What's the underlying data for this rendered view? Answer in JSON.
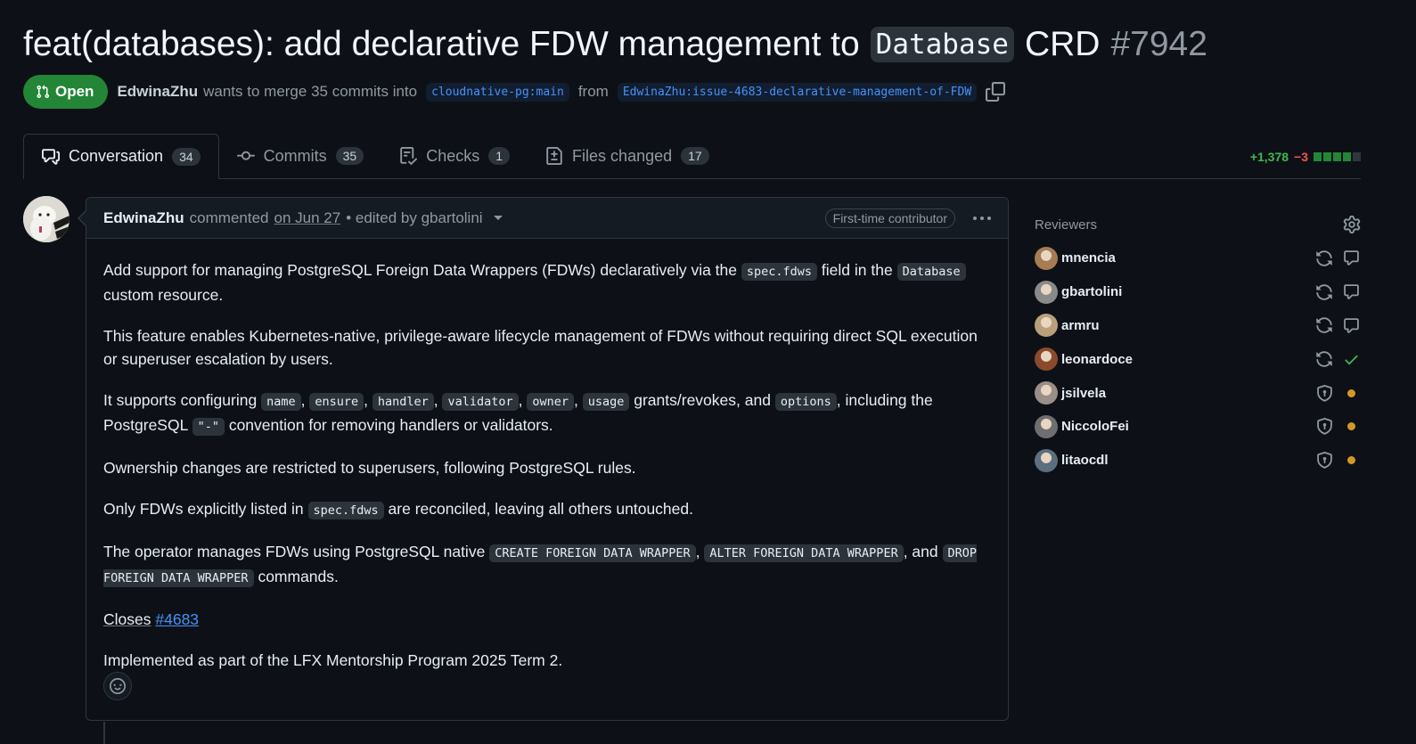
{
  "pr": {
    "title_prefix": "feat(databases): add declarative FDW management to",
    "title_code": "Database",
    "title_suffix": "CRD",
    "number": "#7942",
    "status": "Open",
    "author": "EdwinaZhu",
    "merge_text": "wants to merge 35 commits into",
    "base_branch": "cloudnative-pg:main",
    "from_text": "from",
    "head_branch": "EdwinaZhu:issue-4683-declarative-management-of-FDW"
  },
  "tabs": [
    {
      "label": "Conversation",
      "count": "34"
    },
    {
      "label": "Commits",
      "count": "35"
    },
    {
      "label": "Checks",
      "count": "1"
    },
    {
      "label": "Files changed",
      "count": "17"
    }
  ],
  "diffstat": {
    "additions": "+1,378",
    "deletions": "−3"
  },
  "comment": {
    "author": "EdwinaZhu",
    "commented": "commented",
    "date": "on Jun 27",
    "edited": "• edited by gbartolini",
    "badge": "First-time contributor",
    "p1_a": "Add support for managing PostgreSQL Foreign Data Wrappers (FDWs) declaratively via the",
    "p1_code1": "spec.fdws",
    "p1_b": "field in the",
    "p1_code2": "Database",
    "p1_c": "custom resource.",
    "p2": "This feature enables Kubernetes-native, privilege-aware lifecycle management of FDWs without requiring direct SQL execution or superuser escalation by users.",
    "p3_a": "It supports configuring",
    "p3_codes": [
      "name",
      "ensure",
      "handler",
      "validator",
      "owner",
      "usage"
    ],
    "p3_b": "grants/revokes, and",
    "p3_code_options": "options",
    "p3_c": ", including the PostgreSQL",
    "p3_code_dash": "\"-\"",
    "p3_d": "convention for removing handlers or validators.",
    "p4": "Ownership changes are restricted to superusers, following PostgreSQL rules.",
    "p5_a": "Only FDWs explicitly listed in",
    "p5_code": "spec.fdws",
    "p5_b": "are reconciled, leaving all others untouched.",
    "p6_a": "The operator manages FDWs using PostgreSQL native",
    "p6_code1": "CREATE FOREIGN DATA WRAPPER",
    "p6_code2": "ALTER FOREIGN DATA WRAPPER",
    "p6_and": ", and",
    "p6_code3": "DROP FOREIGN DATA WRAPPER",
    "p6_b": "commands.",
    "closes": "Closes",
    "closes_link": "#4683",
    "p8": "Implemented as part of the LFX Mentorship Program 2025 Term 2."
  },
  "sidebar": {
    "reviewers_label": "Reviewers",
    "reviewers": [
      {
        "name": "mnencia",
        "status": "comment",
        "avatar_color": "#a67c52"
      },
      {
        "name": "gbartolini",
        "status": "comment",
        "avatar_color": "#8a8a8a"
      },
      {
        "name": "armru",
        "status": "comment",
        "avatar_color": "#b9a07a"
      },
      {
        "name": "leonardoce",
        "status": "approved",
        "avatar_color": "#8b4a2b"
      },
      {
        "name": "jsilvela",
        "status": "pending",
        "avatar_color": "#9a8f86"
      },
      {
        "name": "NiccoloFei",
        "status": "pending",
        "avatar_color": "#6f6f6f"
      },
      {
        "name": "litaocdl",
        "status": "pending",
        "avatar_color": "#5c6f7e"
      }
    ]
  }
}
